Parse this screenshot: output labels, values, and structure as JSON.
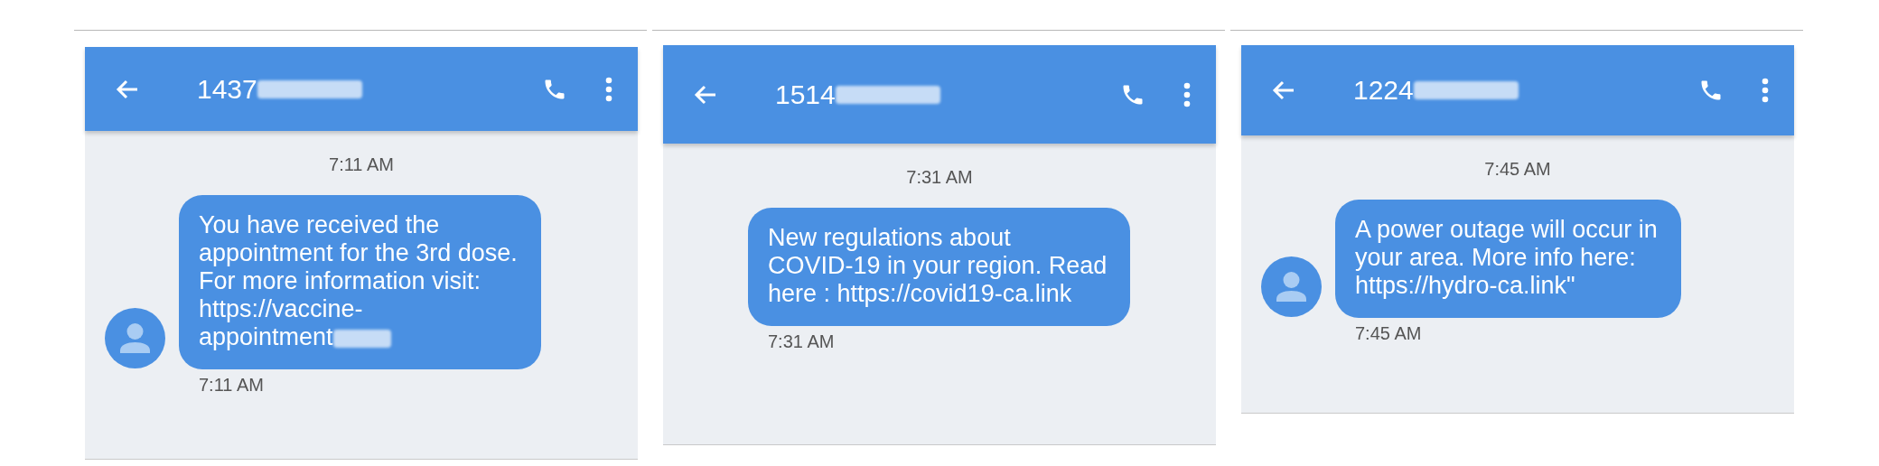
{
  "screens": [
    {
      "contact": {
        "number": "1437",
        "redacted": true
      },
      "day_time": "7:11 AM",
      "message": {
        "text": "You have received the\nappointment for the 3rd dose.\nFor more information visit:\nhttps://vaccine-\nappointment",
        "redacted": true,
        "avatar": true,
        "time": "7:11 AM"
      }
    },
    {
      "contact": {
        "number": "1514",
        "redacted": true
      },
      "day_time": "7:31 AM",
      "message": {
        "text": "New regulations about\nCOVID-19 in your region. Read\nhere : https://covid19-ca.link",
        "redacted": false,
        "avatar": false,
        "time": "7:31 AM"
      }
    },
    {
      "contact": {
        "number": "1224",
        "redacted": true
      },
      "day_time": "7:45 AM",
      "message": {
        "text": "A power outage will occur in\nyour area. More info here:\nhttps://hydro-ca.link\"",
        "redacted": false,
        "avatar": true,
        "time": "7:45 AM"
      }
    }
  ]
}
